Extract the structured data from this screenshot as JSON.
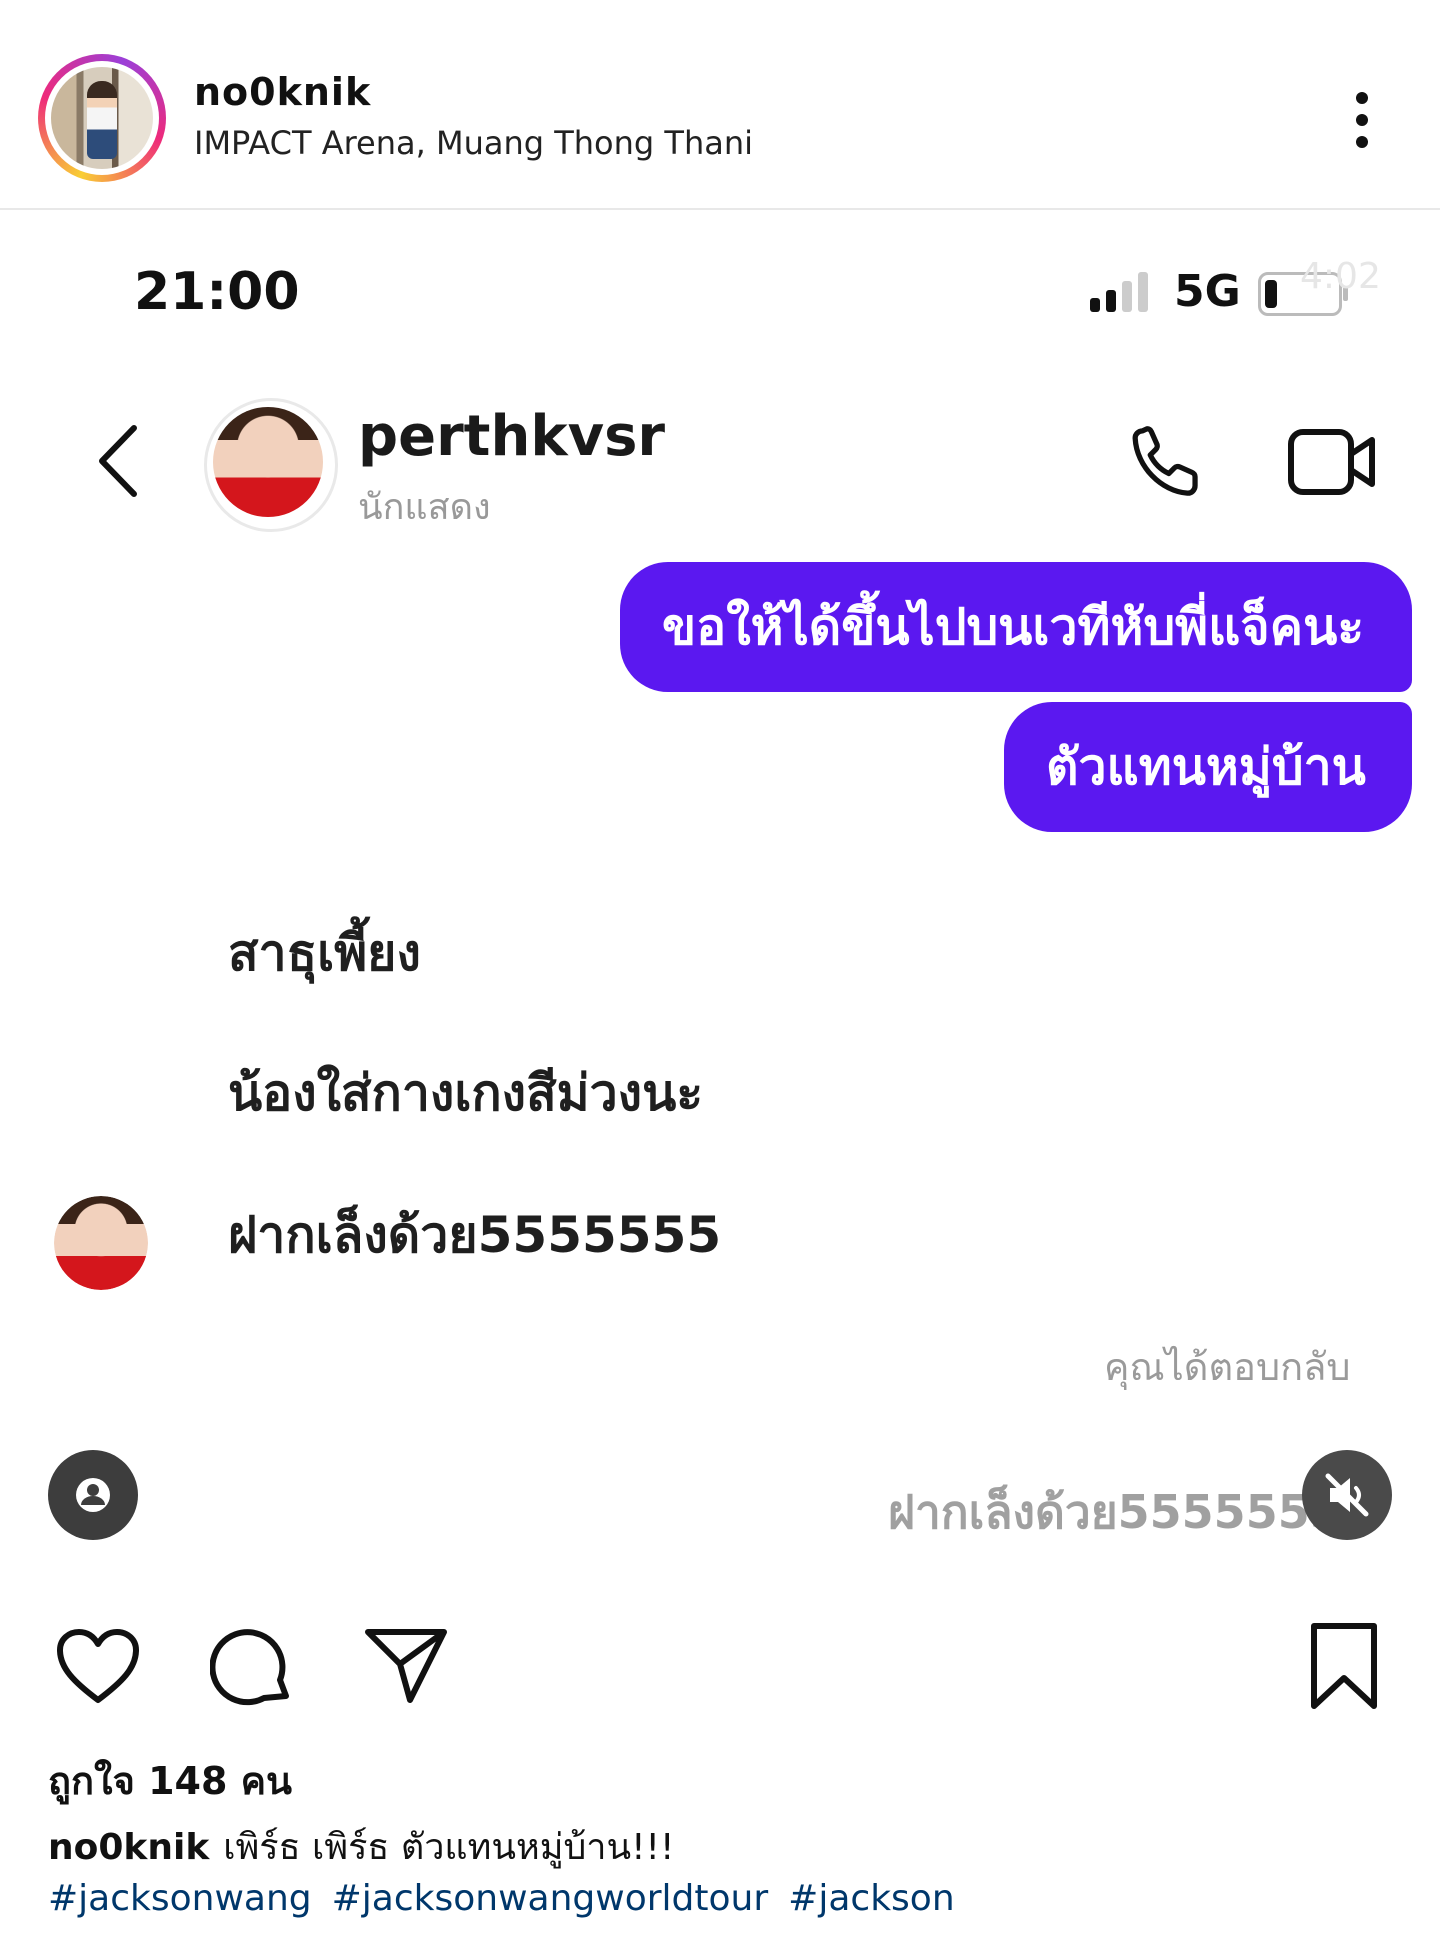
{
  "post": {
    "username": "no0knik",
    "location": "IMPACT Arena, Muang Thong Thani"
  },
  "screenshot": {
    "status_bar": {
      "time": "21:00",
      "network": "5G",
      "overlay_time": "4:02"
    },
    "chat_header": {
      "name": "perthkvsr",
      "subtitle": "นักแสดง"
    },
    "sent_messages": [
      "ขอให้ได้ขึ้นไปบนเวทีหับพี่แจ็คนะ",
      "ตัวแทนหมู่บ้าน"
    ],
    "received_messages": [
      "สาธุเพี้ยง",
      "น้องใส่กางเกงสีม่วงนะ",
      "ฝากเล็งด้วย5555555"
    ],
    "replied_label": "คุณได้ตอบกลับ",
    "reply_preview": "ฝากเล็งด้วย5555555",
    "accent_color": "#5b18f0"
  },
  "actions": {
    "icons": [
      "heart-icon",
      "comment-icon",
      "share-icon",
      "save-icon"
    ]
  },
  "likes": "ถูกใจ 148 คน",
  "caption": {
    "username": "no0knik",
    "text": "เพิร์ธ เพิร์ธ ตัวแทนหมู่บ้าน!!!"
  },
  "hashtags": [
    "#jacksonwang",
    "#jacksonwangworldtour",
    "#jackson"
  ]
}
